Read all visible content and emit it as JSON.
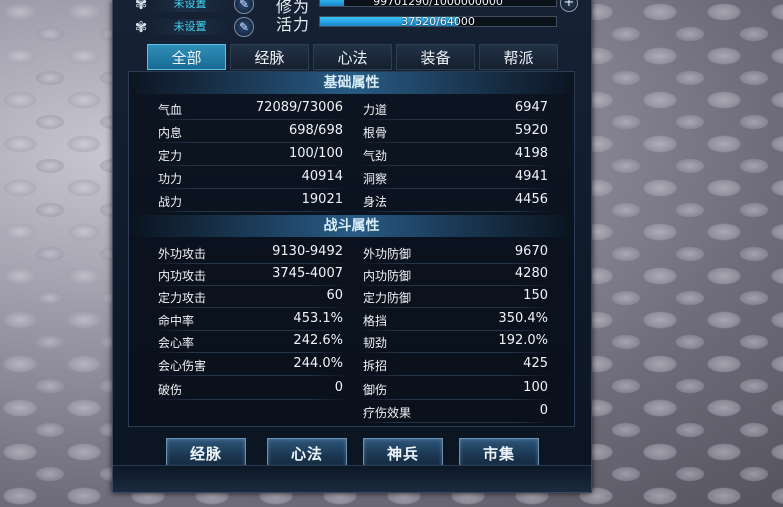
{
  "colors": {
    "accent": "#3fd6f0",
    "bar": "#39c6ff",
    "panel": "#0f1a29"
  },
  "top": {
    "slots": [
      {
        "icon": "flower-icon",
        "label": "未设置"
      },
      {
        "icon": "flower-icon",
        "label": "未设置"
      }
    ],
    "cultivation": {
      "label": "修为",
      "value_text": "99701290/1000000000",
      "fraction": 0.0997
    },
    "vitality": {
      "label": "活力",
      "value_text": "37520/64000",
      "fraction": 0.586
    }
  },
  "tabs": [
    "全部",
    "经脉",
    "心法",
    "装备",
    "帮派"
  ],
  "active_tab": 0,
  "basic": {
    "title": "基础属性",
    "left": [
      {
        "k": "气血",
        "v": "72089/73006"
      },
      {
        "k": "内息",
        "v": "698/698"
      },
      {
        "k": "定力",
        "v": "100/100"
      },
      {
        "k": "功力",
        "v": "40914"
      },
      {
        "k": "战力",
        "v": "19021"
      }
    ],
    "right": [
      {
        "k": "力道",
        "v": "6947"
      },
      {
        "k": "根骨",
        "v": "5920"
      },
      {
        "k": "气劲",
        "v": "4198"
      },
      {
        "k": "洞察",
        "v": "4941"
      },
      {
        "k": "身法",
        "v": "4456"
      }
    ]
  },
  "combat": {
    "title": "战斗属性",
    "left": [
      {
        "k": "外功攻击",
        "v": "9130-9492"
      },
      {
        "k": "内功攻击",
        "v": "3745-4007"
      },
      {
        "k": "定力攻击",
        "v": "60"
      },
      {
        "k": "命中率",
        "v": "453.1%"
      },
      {
        "k": "会心率",
        "v": "242.6%"
      },
      {
        "k": "会心伤害",
        "v": "244.0%"
      },
      {
        "k": "破伤",
        "v": "0"
      }
    ],
    "right": [
      {
        "k": "外功防御",
        "v": "9670"
      },
      {
        "k": "内功防御",
        "v": "4280"
      },
      {
        "k": "定力防御",
        "v": "150"
      },
      {
        "k": "格挡",
        "v": "350.4%"
      },
      {
        "k": "韧劲",
        "v": "192.0%"
      },
      {
        "k": "拆招",
        "v": "425"
      },
      {
        "k": "御伤",
        "v": "100"
      },
      {
        "k": "疗伤效果",
        "v": "0"
      }
    ]
  },
  "bottom_buttons": [
    "经脉",
    "心法",
    "神兵",
    "市集"
  ]
}
